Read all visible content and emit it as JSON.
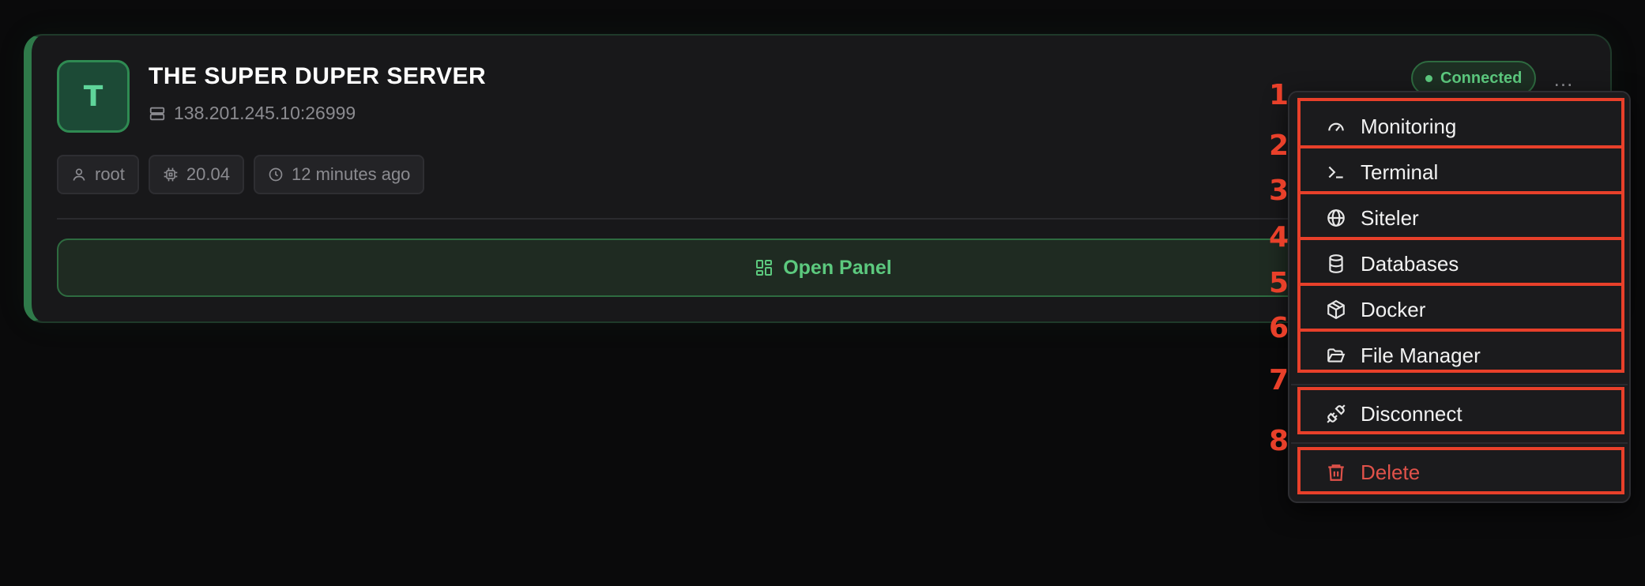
{
  "server": {
    "avatar_letter": "T",
    "name": "THE SUPER DUPER SERVER",
    "address": "138.201.245.10:26999",
    "user": "root",
    "os_version": "20.04",
    "last_seen": "12 minutes ago",
    "status": "Connected",
    "open_panel_label": "Open Panel",
    "more_label": "..."
  },
  "menu": {
    "items": [
      {
        "label": "Monitoring",
        "icon": "gauge-icon"
      },
      {
        "label": "Terminal",
        "icon": "terminal-icon"
      },
      {
        "label": "Siteler",
        "icon": "globe-icon"
      },
      {
        "label": "Databases",
        "icon": "database-icon"
      },
      {
        "label": "Docker",
        "icon": "container-icon"
      },
      {
        "label": "File Manager",
        "icon": "folder-icon"
      },
      {
        "label": "Disconnect",
        "icon": "unplug-icon"
      },
      {
        "label": "Delete",
        "icon": "trash-icon"
      }
    ]
  },
  "annotations": {
    "numbers": [
      "1",
      "2",
      "3",
      "4",
      "5",
      "6",
      "7",
      "8"
    ],
    "color": "#e8402a"
  },
  "colors": {
    "accent_green": "#5cc97e",
    "danger_red": "#e0524a",
    "background": "#0a0a0b",
    "card": "#18181a"
  }
}
